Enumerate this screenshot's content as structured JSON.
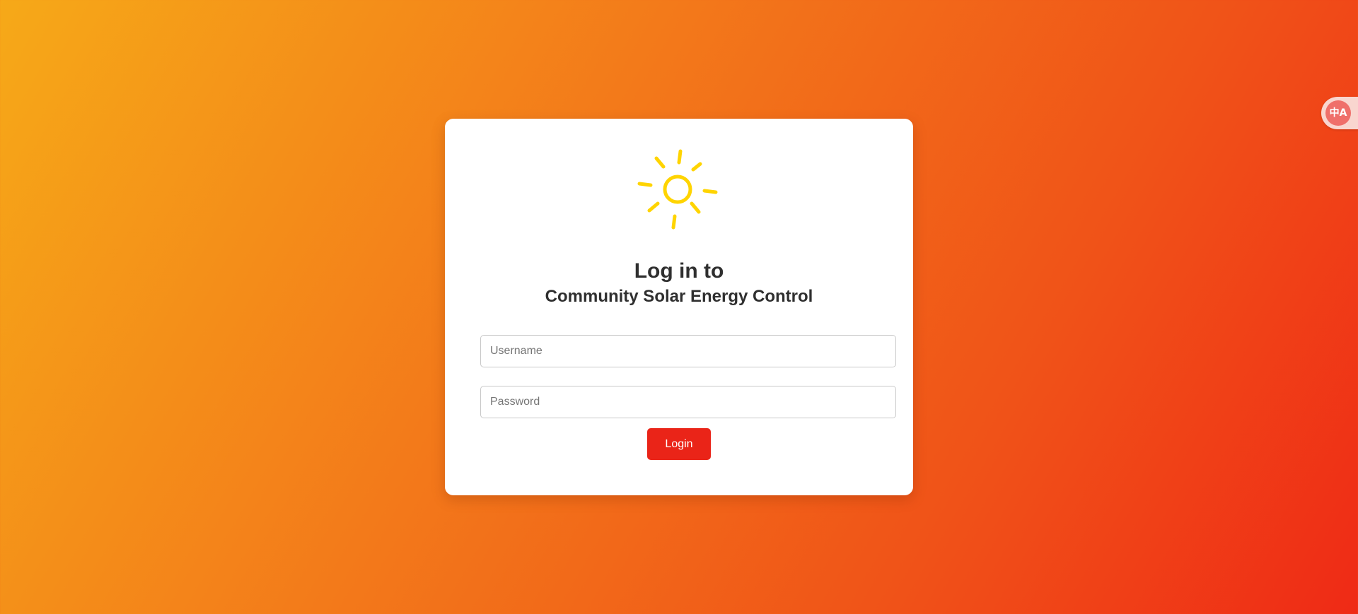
{
  "login": {
    "title": "Log in to",
    "subtitle": "Community Solar Energy Control",
    "username_placeholder": "Username",
    "password_placeholder": "Password",
    "login_button_label": "Login",
    "logo_icon": "sun-icon"
  },
  "translate_widget": {
    "icon_name": "translate-icon",
    "glyph": "中A"
  },
  "colors": {
    "accent": "#ea2418",
    "sun": "#ffd400",
    "background_start": "#f6a918",
    "background_end": "#ef2a16"
  }
}
